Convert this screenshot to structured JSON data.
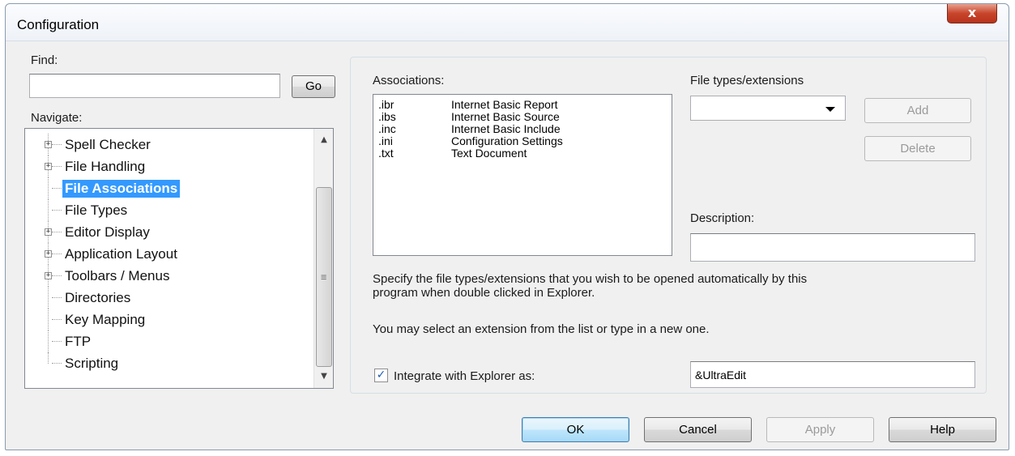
{
  "window": {
    "title": "Configuration",
    "close_label": "x"
  },
  "find": {
    "label": "Find:",
    "value": "",
    "go_label": "Go"
  },
  "navigate": {
    "label": "Navigate:",
    "items": [
      {
        "label": "Spell Checker",
        "expandable": true
      },
      {
        "label": "File Handling",
        "expandable": true
      },
      {
        "label": "File Associations",
        "expandable": false,
        "selected": true
      },
      {
        "label": "File Types",
        "expandable": false
      },
      {
        "label": "Editor Display",
        "expandable": true
      },
      {
        "label": "Application Layout",
        "expandable": true
      },
      {
        "label": "Toolbars / Menus",
        "expandable": true
      },
      {
        "label": "Directories",
        "expandable": false
      },
      {
        "label": "Key Mapping",
        "expandable": false
      },
      {
        "label": "FTP",
        "expandable": false
      },
      {
        "label": "Scripting",
        "expandable": false
      }
    ],
    "scroll_up_icon": "▲",
    "scroll_down_icon": "▼",
    "grip_icon": "≡"
  },
  "associations": {
    "label": "Associations:",
    "rows": [
      {
        "ext": ".ibr",
        "desc": "Internet Basic Report"
      },
      {
        "ext": ".ibs",
        "desc": "Internet Basic Source"
      },
      {
        "ext": ".inc",
        "desc": "Internet Basic Include"
      },
      {
        "ext": ".ini",
        "desc": "Configuration Settings"
      },
      {
        "ext": ".txt",
        "desc": "Text Document"
      }
    ]
  },
  "file_types": {
    "label": "File types/extensions",
    "selected_value": "",
    "add_label": "Add",
    "delete_label": "Delete"
  },
  "description": {
    "label": "Description:",
    "value": ""
  },
  "help_text": {
    "line1": "Specify the file types/extensions that you wish to be opened automatically by this",
    "line2": "program when double clicked in Explorer.",
    "line3": "You may select an extension from the list or type in a new one."
  },
  "integrate": {
    "checked": true,
    "check_mark": "✓",
    "label": "Integrate with Explorer as:",
    "value": "&UltraEdit"
  },
  "footer": {
    "ok_label": "OK",
    "cancel_label": "Cancel",
    "apply_label": "Apply",
    "help_label": "Help"
  }
}
